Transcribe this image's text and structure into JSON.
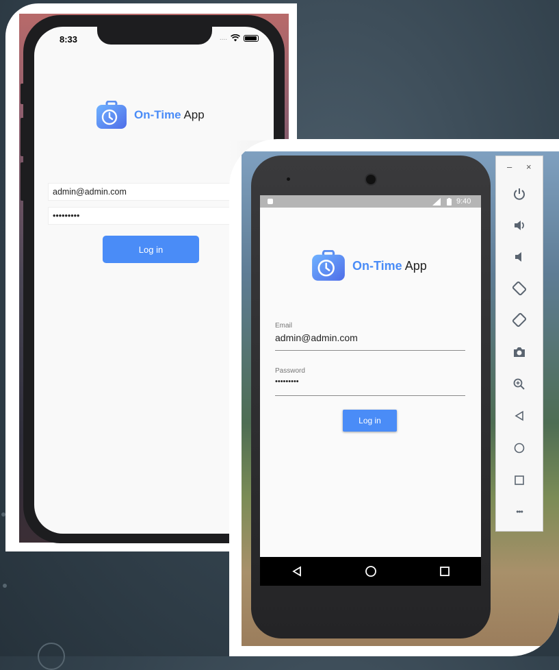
{
  "app": {
    "brand_primary": "On-Time",
    "brand_secondary": "App",
    "accent_color": "#4a8cf7"
  },
  "ios": {
    "status_time": "8:33",
    "status_carrier": "....",
    "email_value": "admin@admin.com",
    "password_value": "•••••••••",
    "login_label": "Log in"
  },
  "android": {
    "status_time": "9:40",
    "email_label": "Email",
    "email_value": "admin@admin.com",
    "password_label": "Password",
    "password_value": "•••••••••",
    "login_label": "Log in"
  },
  "emulator": {
    "minimize_label": "–",
    "close_label": "×",
    "tools": [
      "power-icon",
      "volume-up-icon",
      "volume-down-icon",
      "rotate-left-icon",
      "rotate-right-icon",
      "camera-icon",
      "zoom-icon",
      "back-icon",
      "home-icon",
      "overview-icon",
      "more-icon"
    ],
    "more_label": "•••"
  }
}
